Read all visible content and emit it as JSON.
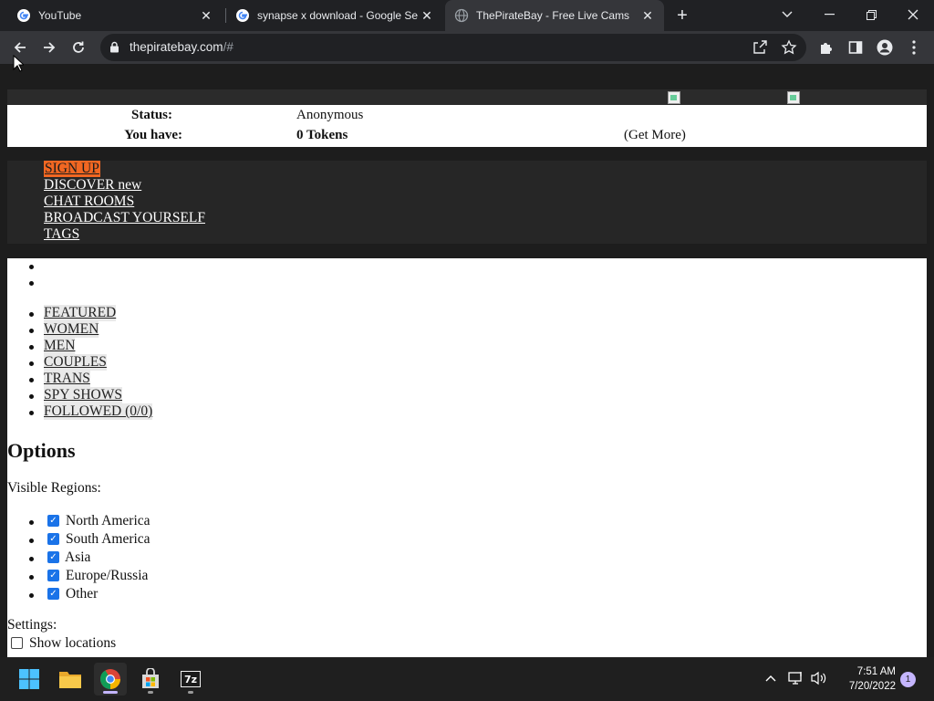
{
  "browser": {
    "tabs": [
      {
        "title": "YouTube",
        "active": false
      },
      {
        "title": "synapse x download - Google Se",
        "active": false
      },
      {
        "title": "ThePirateBay - Free Live Cams",
        "active": true
      }
    ],
    "url_host": "thepiratebay.com",
    "url_path": "/#"
  },
  "page": {
    "status": {
      "status_label": "Status:",
      "status_value": "Anonymous",
      "tokens_label": "You have:",
      "tokens_value": "0 Tokens",
      "get_more": "(Get More)"
    },
    "nav": {
      "signup": "SIGN UP",
      "discover": "DISCOVER new",
      "chat_rooms": "CHAT ROOMS",
      "broadcast": "BROADCAST YOURSELF",
      "tags": "TAGS"
    },
    "categories": [
      "FEATURED",
      "WOMEN",
      "MEN",
      "COUPLES",
      "TRANS",
      "SPY SHOWS",
      "FOLLOWED (0/0)"
    ],
    "options": {
      "heading": "Options",
      "regions_label": "Visible Regions:",
      "regions": [
        {
          "label": "North America",
          "checked": true
        },
        {
          "label": "South America",
          "checked": true
        },
        {
          "label": "Asia",
          "checked": true
        },
        {
          "label": "Europe/Russia",
          "checked": true
        },
        {
          "label": "Other",
          "checked": true
        }
      ],
      "settings_label": "Settings:",
      "show_locations": {
        "label": "Show locations",
        "checked": false
      }
    }
  },
  "taskbar": {
    "time": "7:51 AM",
    "date": "7/20/2022",
    "notifications": "1"
  },
  "colors": {
    "signup_bg": "#f26722",
    "checkbox": "#1a73e8",
    "chrome_dark": "#202124",
    "chrome_toolbar": "#35363a"
  }
}
